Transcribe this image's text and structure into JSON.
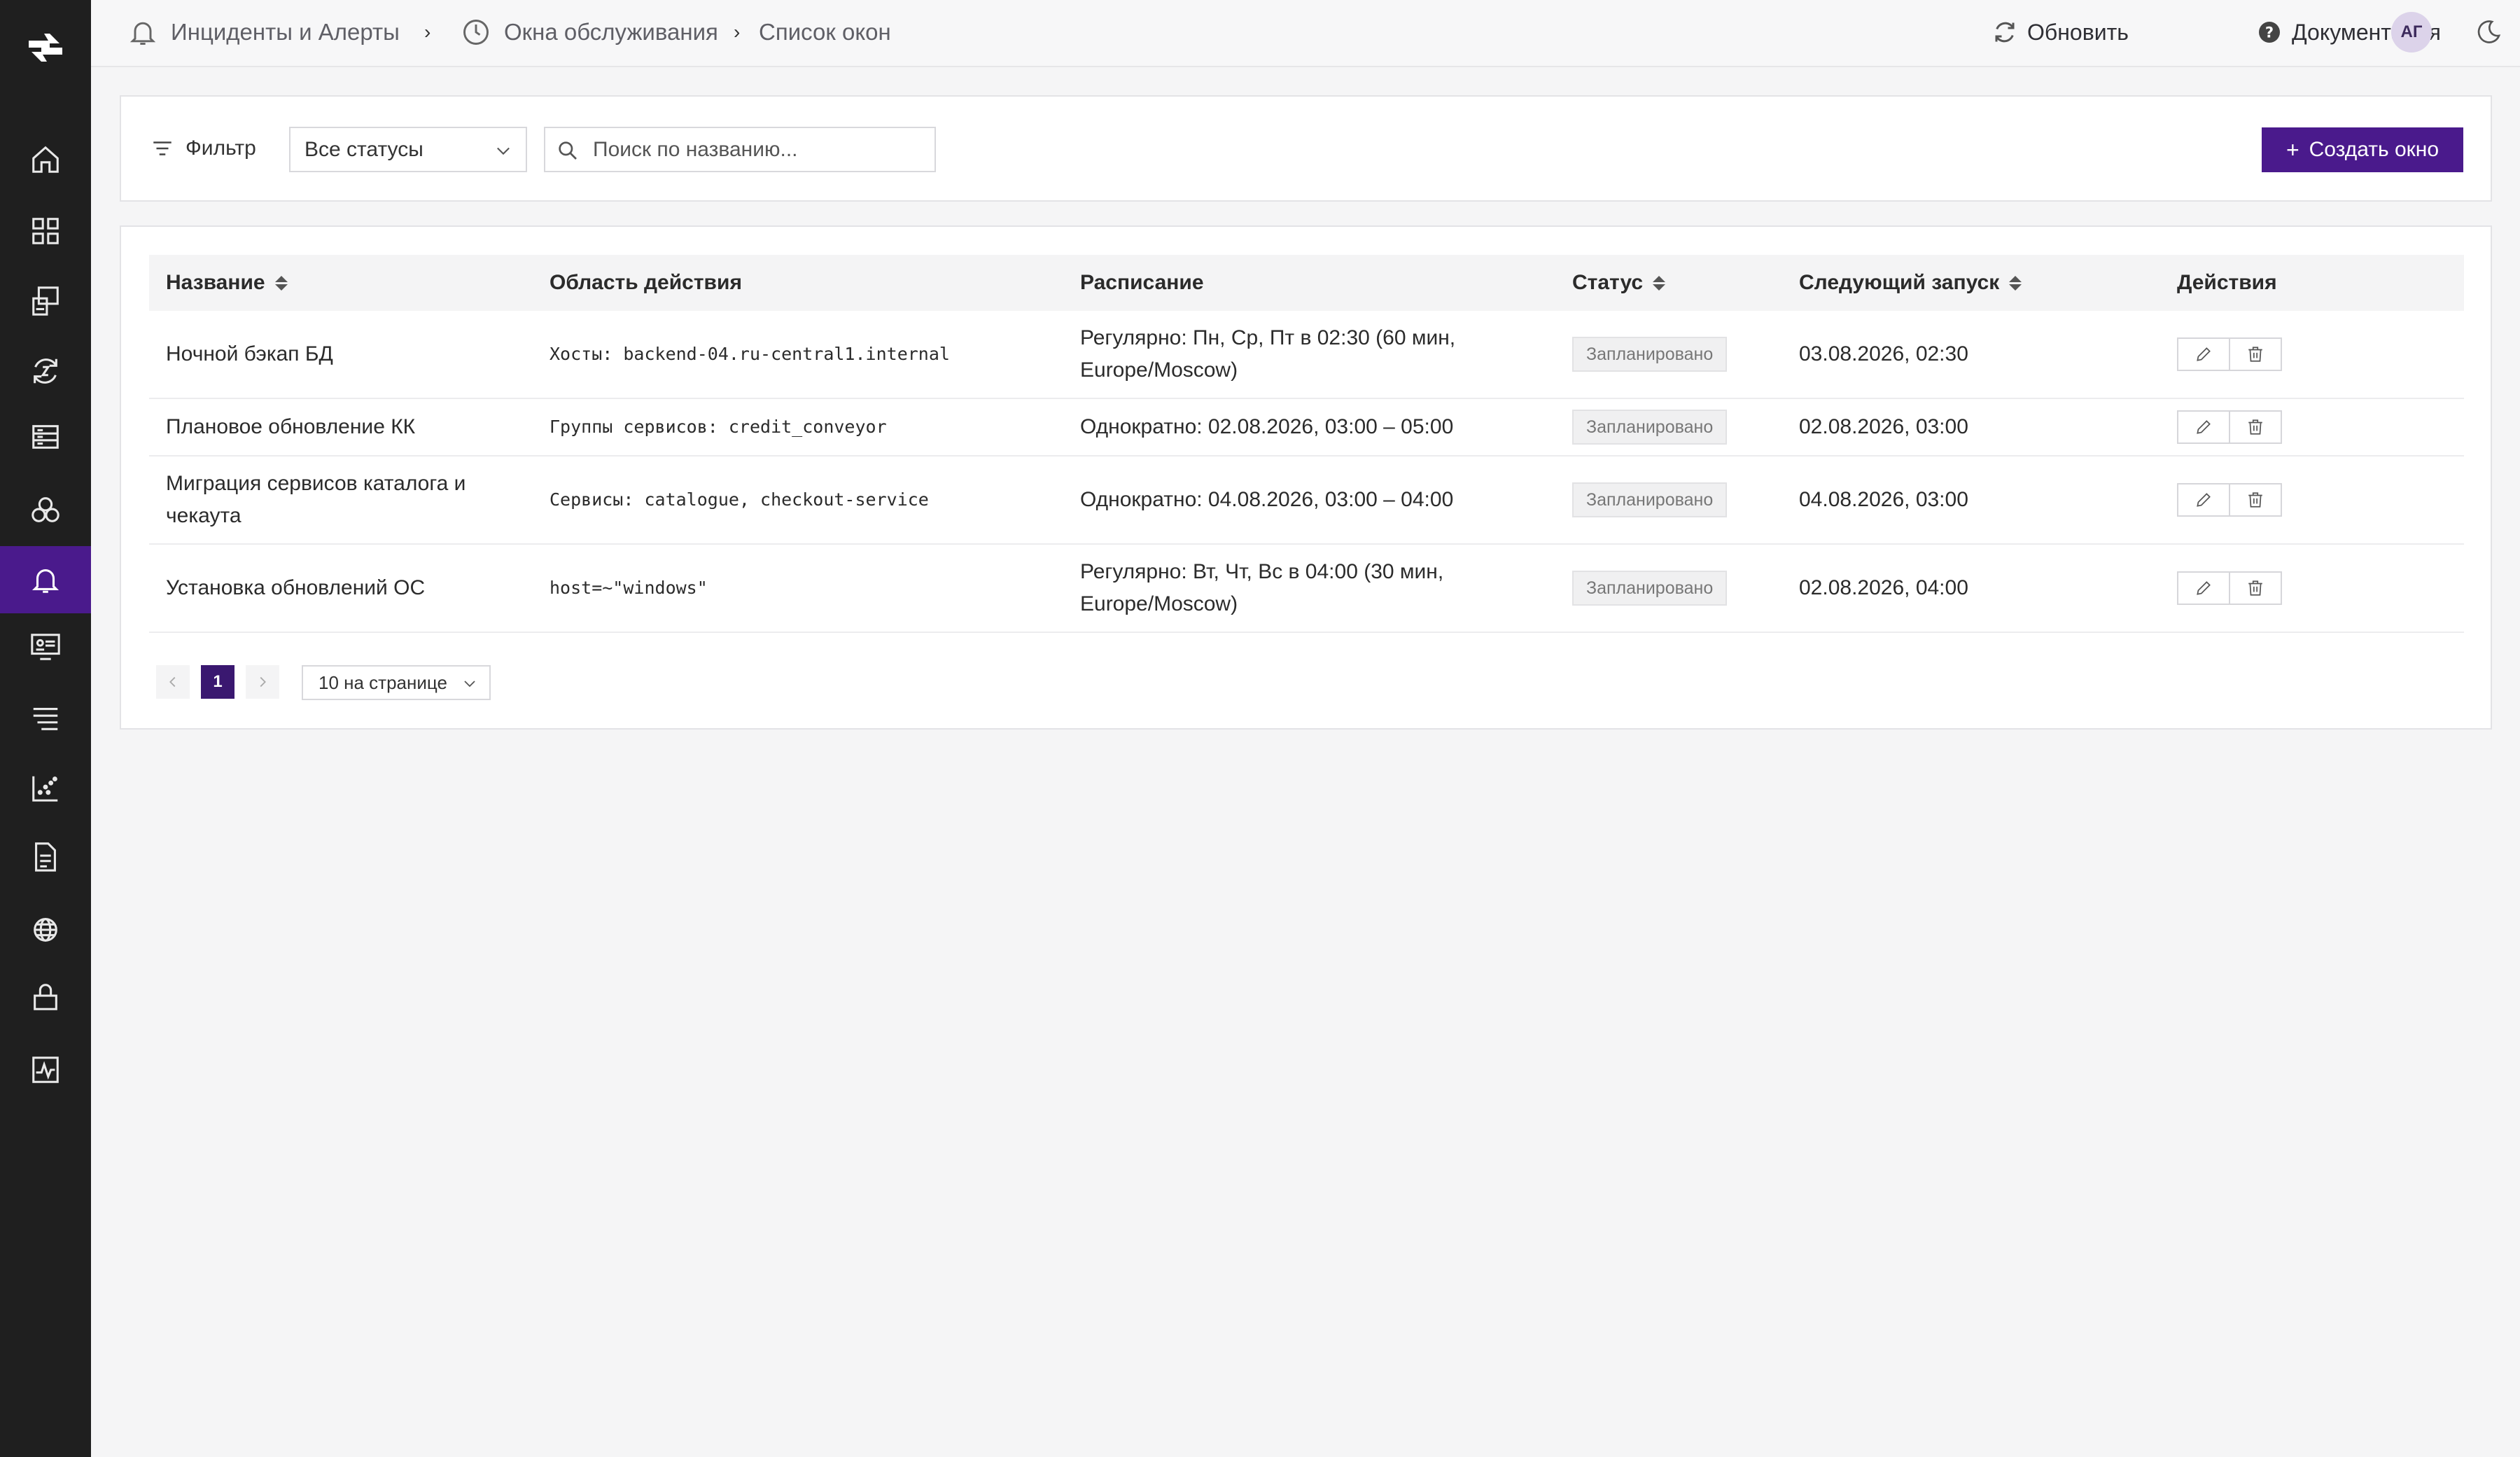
{
  "header": {
    "breadcrumb": [
      {
        "label": "Инциденты и Алерты",
        "icon": "bell-icon"
      },
      {
        "label": "Окна обслуживания",
        "icon": "clock-icon"
      },
      {
        "label": "Список окон"
      }
    ],
    "refresh_label": "Обновить",
    "docs_label": "Документация",
    "avatar_initials": "АГ"
  },
  "sidebar": {
    "items": [
      {
        "name": "home",
        "icon": "home-icon",
        "active": false
      },
      {
        "name": "dashboards",
        "icon": "grid-icon",
        "active": false
      },
      {
        "name": "services",
        "icon": "server-icon",
        "active": false
      },
      {
        "name": "sync",
        "icon": "sync-icon",
        "active": false
      },
      {
        "name": "hosts",
        "icon": "rack-icon",
        "active": false
      },
      {
        "name": "components",
        "icon": "cubes-icon",
        "active": false
      },
      {
        "name": "alerts",
        "icon": "bell-icon",
        "active": true
      },
      {
        "name": "monitor",
        "icon": "monitor-icon",
        "active": false
      },
      {
        "name": "logs",
        "icon": "list-icon",
        "active": false
      },
      {
        "name": "metrics",
        "icon": "scatter-icon",
        "active": false
      },
      {
        "name": "documents",
        "icon": "document-icon",
        "active": false
      },
      {
        "name": "integrations",
        "icon": "globe-icon",
        "active": false
      },
      {
        "name": "security",
        "icon": "lock-icon",
        "active": false
      },
      {
        "name": "activity",
        "icon": "pulse-icon",
        "active": false
      }
    ]
  },
  "toolbar": {
    "filter_label": "Фильтр",
    "status_select": "Все статусы",
    "search_placeholder": "Поиск по названию...",
    "create_label": "Создать окно"
  },
  "table": {
    "columns": [
      "Название",
      "Область действия",
      "Расписание",
      "Статус",
      "Следующий запуск",
      "Действия"
    ],
    "rows": [
      {
        "name": "Ночной бэкап БД",
        "scope": "Хосты: backend-04.ru-central1.internal",
        "schedule": "Регулярно: Пн, Ср, Пт в 02:30 (60 мин, Europe/Moscow)",
        "status": "Запланировано",
        "next_run": "03.08.2026, 02:30"
      },
      {
        "name": "Плановое обновление КК",
        "scope": "Группы сервисов: credit_conveyor",
        "schedule": "Однократно: 02.08.2026, 03:00 – 05:00",
        "status": "Запланировано",
        "next_run": "02.08.2026, 03:00"
      },
      {
        "name": "Миграция сервисов каталога и чекаута",
        "scope": "Сервисы: catalogue, checkout-service",
        "schedule": "Однократно: 04.08.2026, 03:00 – 04:00",
        "status": "Запланировано",
        "next_run": "04.08.2026, 03:00"
      },
      {
        "name": "Установка обновлений ОС",
        "scope": "host=~\"windows\"",
        "schedule": "Регулярно: Вт, Чт, Вс в 04:00 (30 мин, Europe/Moscow)",
        "status": "Запланировано",
        "next_run": "02.08.2026, 04:00"
      }
    ]
  },
  "pagination": {
    "current_page": "1",
    "per_page": "10 на странице"
  },
  "colors": {
    "accent": "#4a1a8c",
    "sidebar_bg": "#1f1f1f",
    "page_bg": "#f5f5f6"
  }
}
